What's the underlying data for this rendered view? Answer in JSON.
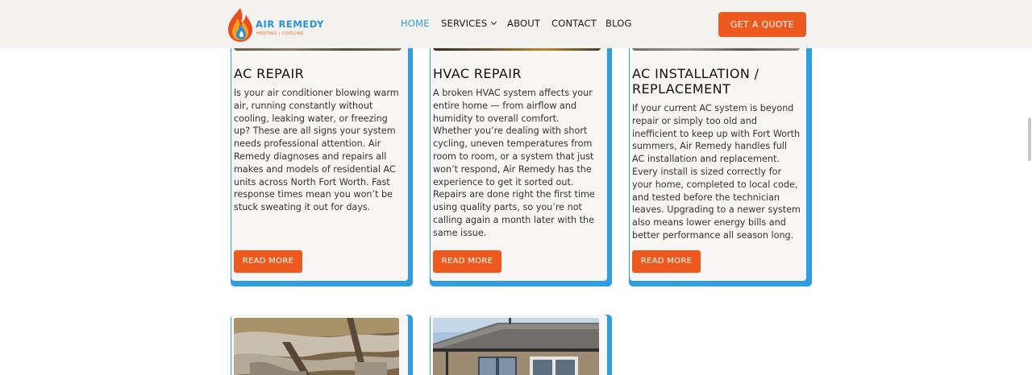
{
  "brand": {
    "name": "AIR REMEDY",
    "tagline": "HEATING | COOLING"
  },
  "nav": {
    "items": [
      {
        "label": "HOME",
        "active": true
      },
      {
        "label": "SERVICES",
        "has_dropdown": true
      },
      {
        "label": "ABOUT"
      },
      {
        "label": "CONTACT"
      },
      {
        "label": "BLOG"
      }
    ],
    "cta": "GET A QUOTE"
  },
  "cards": [
    {
      "title": "AC REPAIR",
      "body": "Is your air conditioner blowing warm air, running constantly without cooling, leaking water, or freezing up? These are all signs your system needs professional attention. Air Remedy diagnoses and repairs all makes and models of residential AC units across North Fort Worth. Fast response times mean you won’t be stuck sweating it out for days.",
      "button": "READ MORE"
    },
    {
      "title": "HVAC REPAIR",
      "body": "A broken HVAC system affects your entire home — from airflow and humidity to overall comfort. Whether you’re dealing with short cycling, uneven temperatures from room to room, or a system that just won’t respond, Air Remedy has the experience to get it sorted out. Repairs are done right the first time using quality parts, so you’re not calling again a month later with the same issue.",
      "button": "READ MORE"
    },
    {
      "title": "AC INSTALLATION / REPLACEMENT",
      "body": "If your current AC system is beyond repair or simply too old and inefficient to keep up with Fort Worth summers, Air Remedy handles full AC installation and replacement. Every install is sized correctly for your home, completed to local code, and tested before the technician leaves. Upgrading to a newer system also means lower energy bills and better performance all season long.",
      "button": "READ MORE"
    }
  ],
  "colors": {
    "accent_orange": "#ec5a1f",
    "accent_blue": "#2f9ee0",
    "nav_active": "#2b9fd9"
  },
  "icons": [
    "flame-drop-logo-icon",
    "chevron-down-icon"
  ]
}
